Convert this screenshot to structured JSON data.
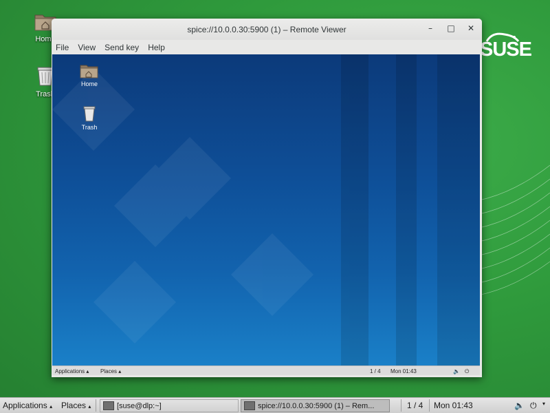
{
  "host_desktop": {
    "logo_text": "SUSE",
    "icons": [
      {
        "label": "Home",
        "icon": "folder-home-icon"
      },
      {
        "label": "Trash",
        "icon": "trash-icon"
      }
    ]
  },
  "window": {
    "title": "spice://10.0.0.30:5900 (1) – Remote Viewer",
    "controls": {
      "minimize": "–",
      "maximize": "□",
      "close": "✕"
    },
    "menu": [
      "File",
      "View",
      "Send key",
      "Help"
    ]
  },
  "guest": {
    "icons": [
      {
        "label": "Home",
        "icon": "folder-home-icon"
      },
      {
        "label": "Trash",
        "icon": "trash-icon"
      }
    ],
    "panel": {
      "applications": "Applications",
      "places": "Places",
      "workspace": "1 / 4",
      "clock": "Mon 01:43"
    }
  },
  "taskbar": {
    "applications": "Applications",
    "places": "Places",
    "tasks": [
      {
        "label": "[suse@dlp:~]",
        "active": false
      },
      {
        "label": "spice://10.0.0.30:5900 (1) – Rem...",
        "active": true
      }
    ],
    "workspace": "1 / 4",
    "clock": "Mon 01:43"
  },
  "colors": {
    "host_green": "#2f9a3c",
    "guest_blue": "#0e4f98",
    "panel_gray": "#dcdcdc"
  }
}
